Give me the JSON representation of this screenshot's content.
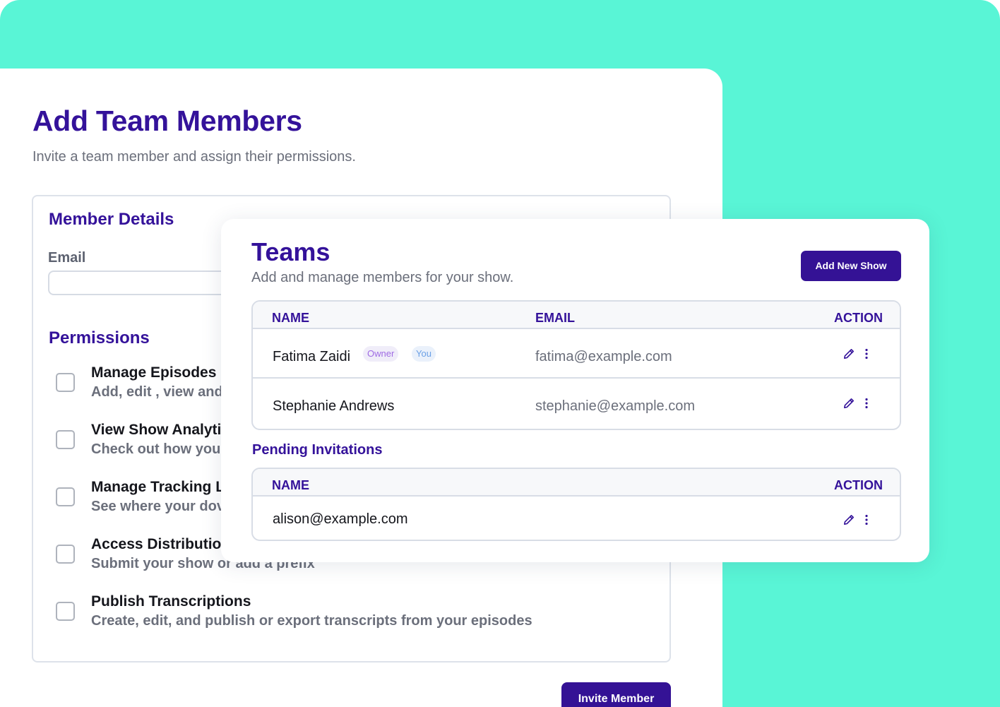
{
  "add_team": {
    "title": "Add Team Members",
    "subtitle": "Invite a team member and assign their permissions.",
    "member_details_title": "Member Details",
    "email_label": "Email",
    "email_value": "",
    "permissions_title": "Permissions",
    "permissions": [
      {
        "title": "Manage Episodes",
        "description": "Add, edit , view and"
      },
      {
        "title": "View Show Analytic",
        "description": "Check out how you"
      },
      {
        "title": "Manage Tracking Li",
        "description": "See where your dov"
      },
      {
        "title": "Access Distribution",
        "description": "Submit your show or add a prefix"
      },
      {
        "title": "Publish Transcriptions",
        "description": "Create, edit, and publish or export transcripts from your episodes"
      }
    ],
    "invite_button": "Invite Member"
  },
  "teams": {
    "title": "Teams",
    "subtitle": "Add and manage members for your show.",
    "add_button": "Add New Show",
    "headers": {
      "name": "NAME",
      "email": "EMAIL",
      "action": "ACTION"
    },
    "members": [
      {
        "name": "Fatima Zaidi",
        "email": "fatima@example.com",
        "badges": [
          "Owner",
          "You"
        ]
      },
      {
        "name": "Stephanie Andrews",
        "email": "stephanie@example.com",
        "badges": []
      }
    ],
    "pending_title": "Pending Invitations",
    "pending_headers": {
      "name": "NAME",
      "action": "ACTION"
    },
    "pending": [
      {
        "name": "alison@example.com"
      }
    ]
  },
  "colors": {
    "accent": "#34129a",
    "button": "#341295",
    "teal_background": "#59f5d6",
    "owner_badge": "#9f6be3",
    "you_badge": "#6ba0e6"
  },
  "icons": {
    "edit": "pencil-icon",
    "more": "more-vertical-icon",
    "checkbox": "checkbox-unchecked"
  }
}
